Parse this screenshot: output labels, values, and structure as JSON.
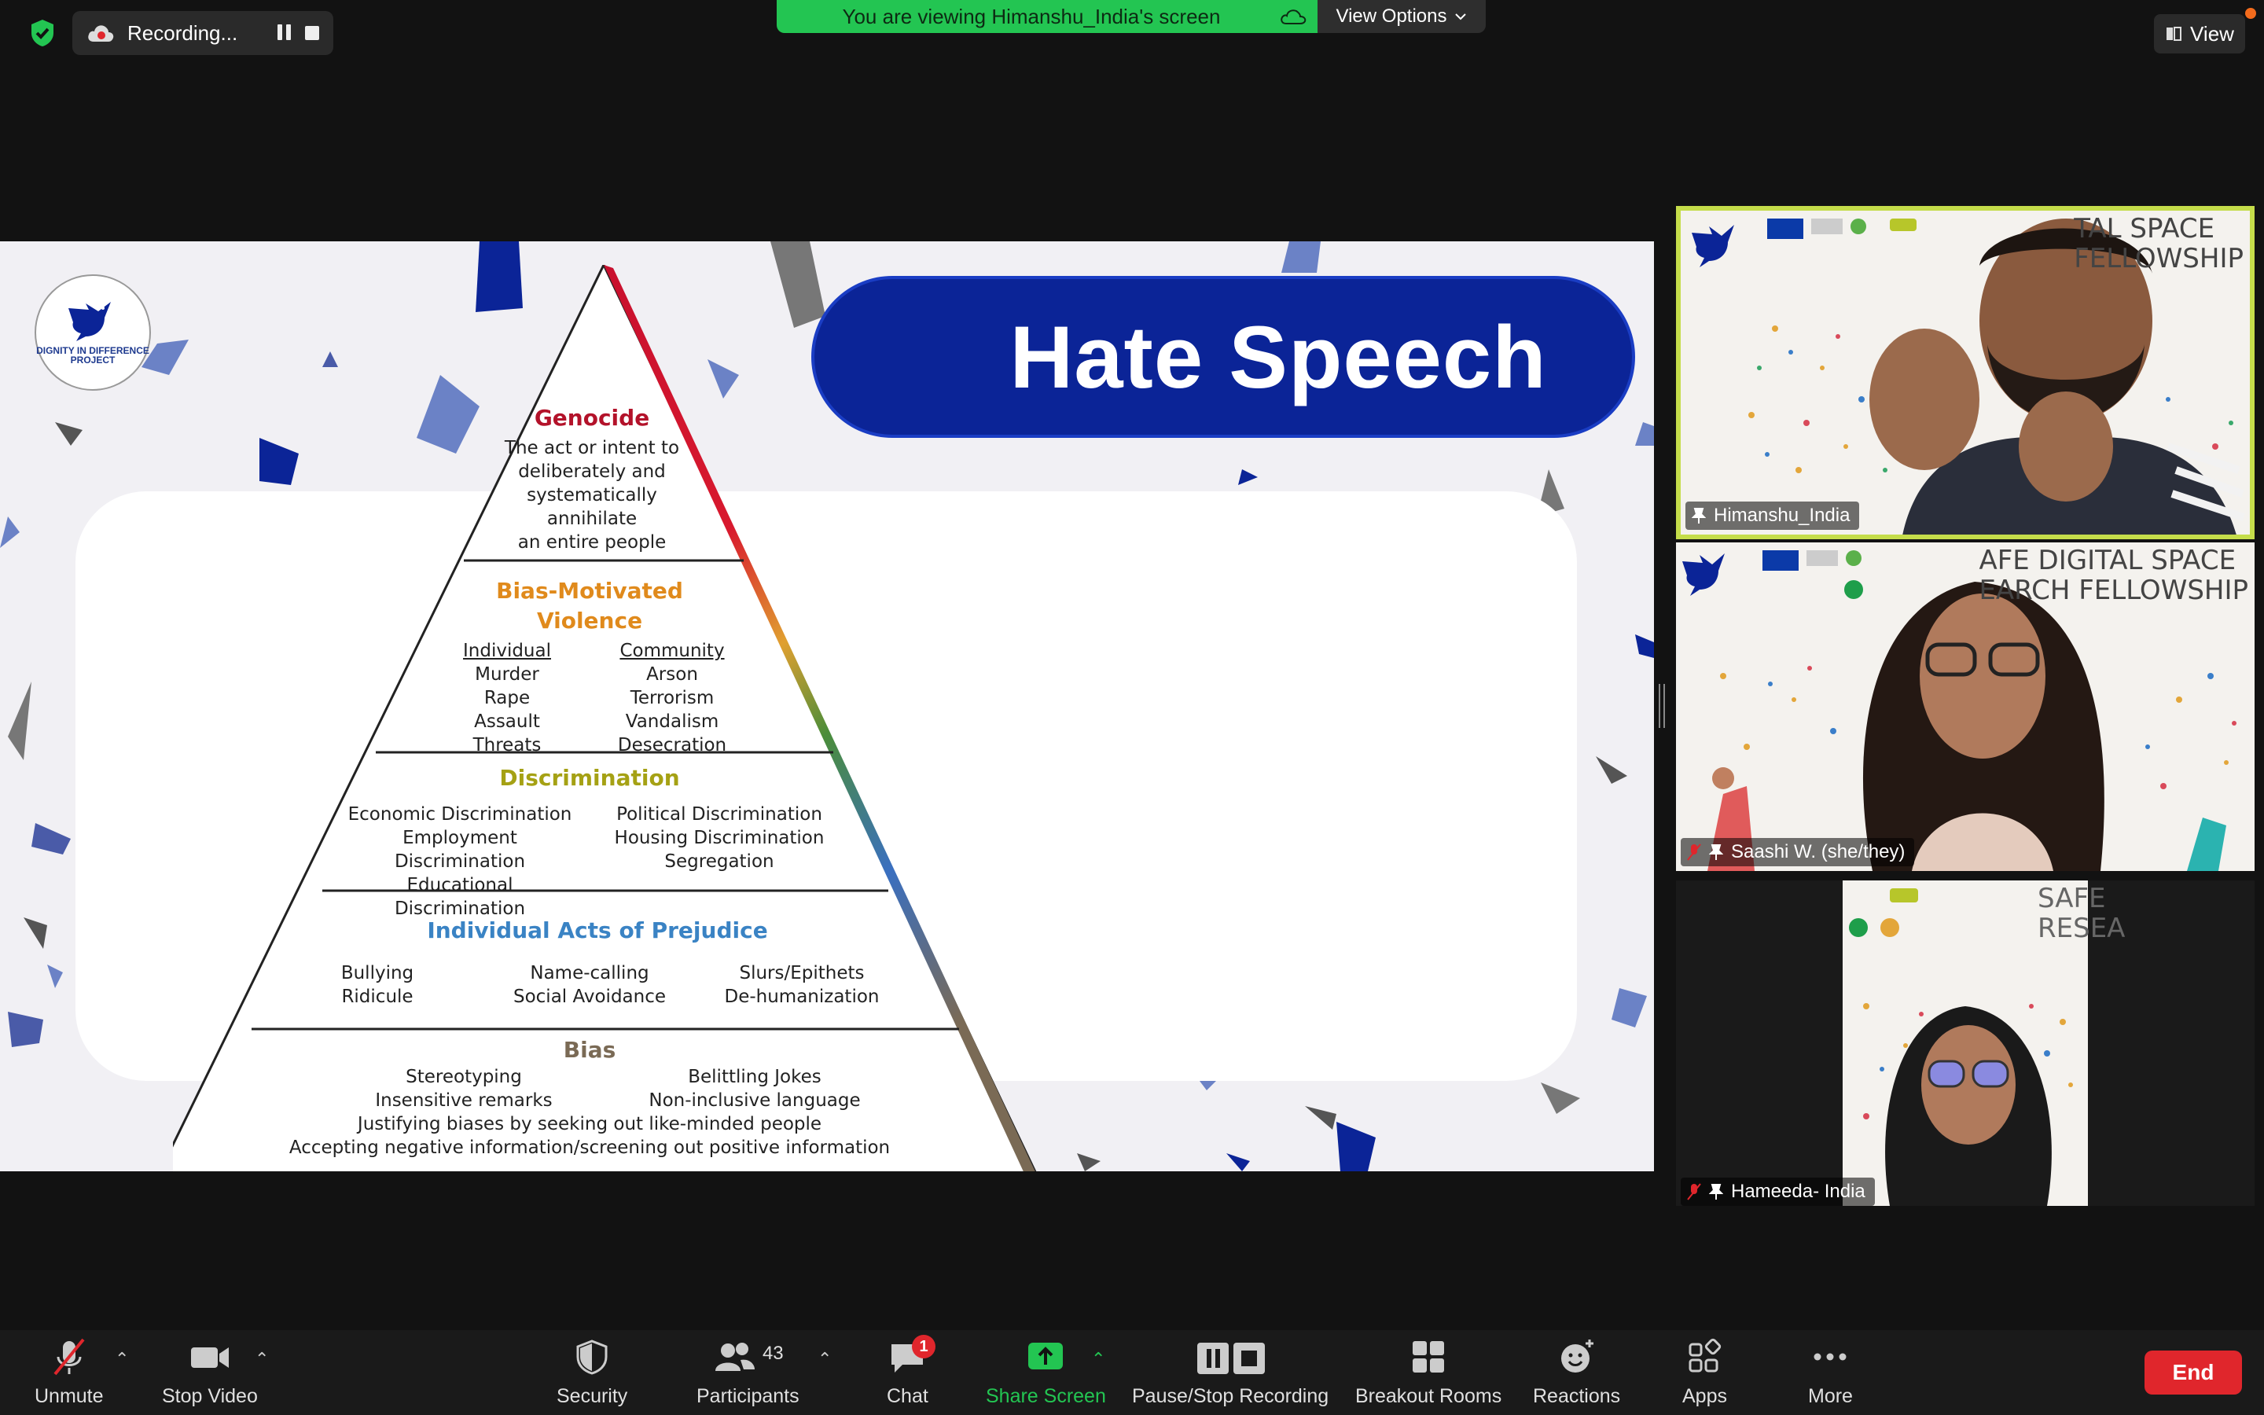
{
  "top_bar": {
    "recording_label": "Recording...",
    "viewing_banner": "You are viewing Himanshu_India's screen",
    "view_options_label": "View Options",
    "view_label": "View"
  },
  "slide": {
    "title": "Hate Speech",
    "logo_text": "DIGNITY IN DIFFERENCE PROJECT",
    "levels": {
      "genocide": {
        "heading": "Genocide",
        "lines": [
          "The act or intent to",
          "deliberately and",
          "systematically",
          "annihilate",
          "an entire people"
        ]
      },
      "violence": {
        "heading_1": "Bias-Motivated",
        "heading_2": "Violence",
        "individual_head": "Individual",
        "individual": [
          "Murder",
          "Rape",
          "Assault",
          "Threats"
        ],
        "community_head": "Community",
        "community": [
          "Arson",
          "Terrorism",
          "Vandalism",
          "Desecration"
        ]
      },
      "discrimination": {
        "heading": "Discrimination",
        "left": [
          "Economic Discrimination",
          "Employment Discrimination",
          "Educational Discrimination"
        ],
        "right": [
          "Political Discrimination",
          "Housing Discrimination",
          "Segregation"
        ]
      },
      "prejudice": {
        "heading": "Individual Acts of Prejudice",
        "col1": [
          "Bullying",
          "Ridicule"
        ],
        "col2": [
          "Name-calling",
          "Social Avoidance"
        ],
        "col3": [
          "Slurs/Epithets",
          "De-humanization"
        ]
      },
      "bias": {
        "heading": "Bias",
        "left": [
          "Stereotyping",
          "Insensitive remarks"
        ],
        "right": [
          "Belittling Jokes",
          "Non-inclusive language"
        ],
        "line3": "Justifying biases by seeking out like-minded people",
        "line4": "Accepting negative information/screening out positive information"
      }
    }
  },
  "participants": [
    {
      "name": "Himanshu_India",
      "banner": [
        "TAL SPACE",
        "FELLOWSHIP"
      ],
      "muted": false,
      "active": true
    },
    {
      "name": "Saashi W.  (she/they)",
      "banner": [
        "AFE DIGITAL SPACE",
        "EARCH FELLOWSHIP"
      ],
      "muted": true
    },
    {
      "name": "Hameeda- India",
      "banner": [
        "SAFE",
        "RESEA"
      ],
      "muted": true
    }
  ],
  "toolbar": {
    "unmute": "Unmute",
    "stop_video": "Stop Video",
    "security": "Security",
    "participants": "Participants",
    "participant_count": "43",
    "chat": "Chat",
    "chat_badge": "1",
    "share_screen": "Share Screen",
    "pause_stop": "Pause/Stop Recording",
    "breakout": "Breakout Rooms",
    "reactions": "Reactions",
    "apps": "Apps",
    "more": "More",
    "end": "End"
  },
  "colors": {
    "share_green": "#23c552",
    "end_red": "#e0262c",
    "active_border": "#c5dd4a",
    "title_blue": "#0b2497"
  }
}
